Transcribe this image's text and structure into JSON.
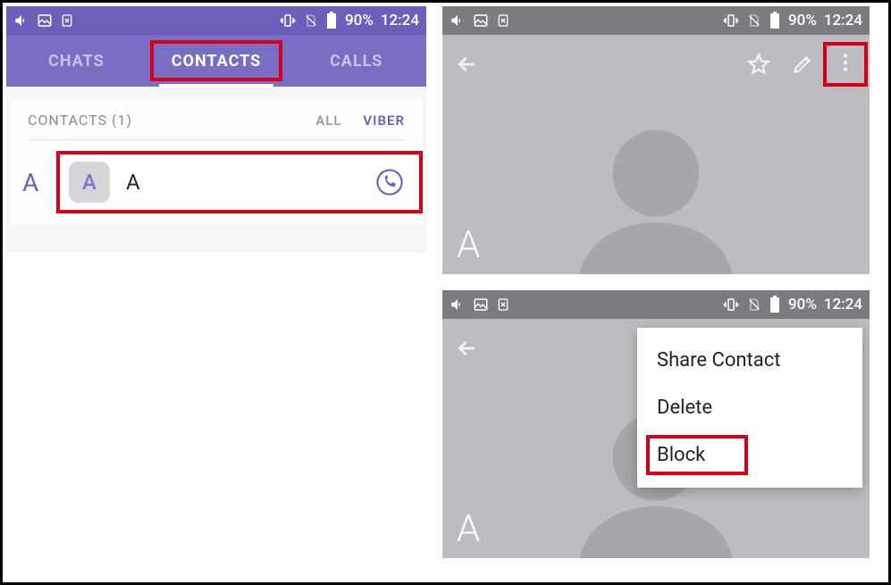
{
  "status": {
    "battery": "90%",
    "time": "12:24"
  },
  "screen1": {
    "tabs": {
      "chats": "CHATS",
      "contacts": "CONTACTS",
      "calls": "CALLS"
    },
    "subheader": "CONTACTS (1)",
    "filters": {
      "all": "ALL",
      "viber": "VIBER"
    },
    "section_letter": "A",
    "contact": {
      "avatar_letter": "A",
      "name": "A"
    }
  },
  "screen2": {
    "letter": "A"
  },
  "screen3": {
    "letter": "A",
    "menu": {
      "share": "Share Contact",
      "delete": "Delete",
      "block": "Block"
    }
  }
}
